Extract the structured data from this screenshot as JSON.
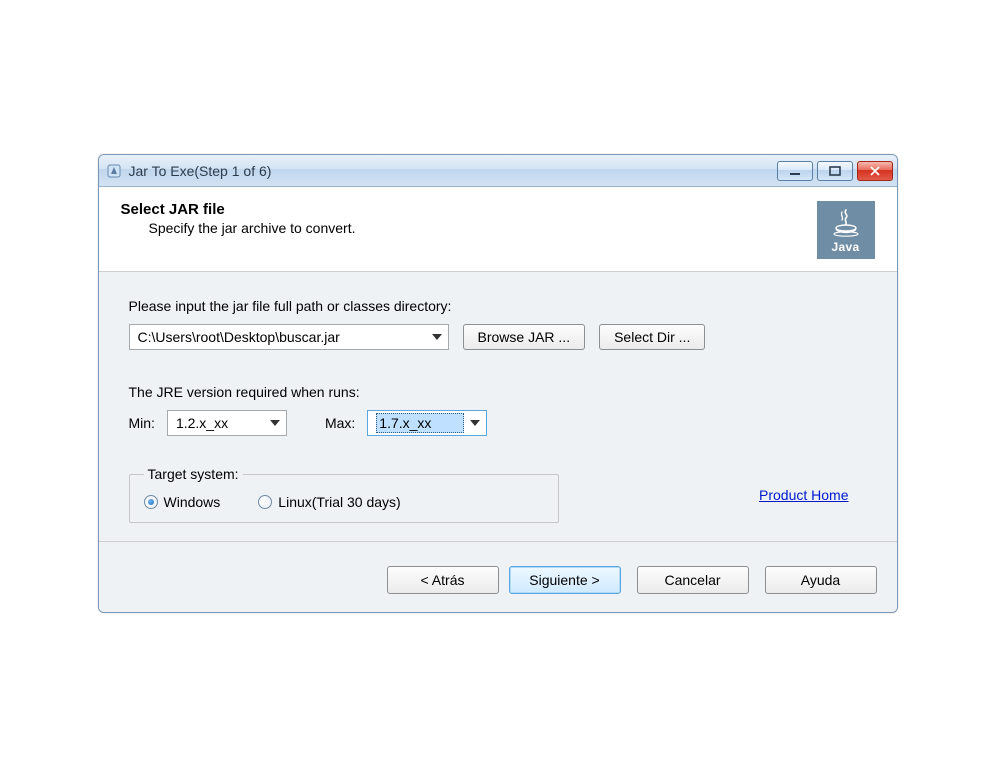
{
  "window": {
    "title": "Jar To Exe(Step 1 of 6)"
  },
  "header": {
    "title": "Select JAR file",
    "subtitle": "Specify the jar archive to convert.",
    "logo_text": "Java"
  },
  "form": {
    "path_prompt": "Please input the jar file full path or classes directory:",
    "path_value": "C:\\Users\\root\\Desktop\\buscar.jar",
    "browse_jar_label": "Browse JAR ...",
    "select_dir_label": "Select Dir ...",
    "jre_prompt": "The JRE version required when runs:",
    "min_label": "Min:",
    "min_value": "1.2.x_xx",
    "max_label": "Max:",
    "max_value": "1.7.x_xx",
    "target_legend": "Target system:",
    "target_windows": "Windows",
    "target_linux": "Linux(Trial 30 days)",
    "product_home": "Product Home"
  },
  "buttons": {
    "back": "< Atrás",
    "next": "Siguiente >",
    "cancel": "Cancelar",
    "help": "Ayuda"
  }
}
